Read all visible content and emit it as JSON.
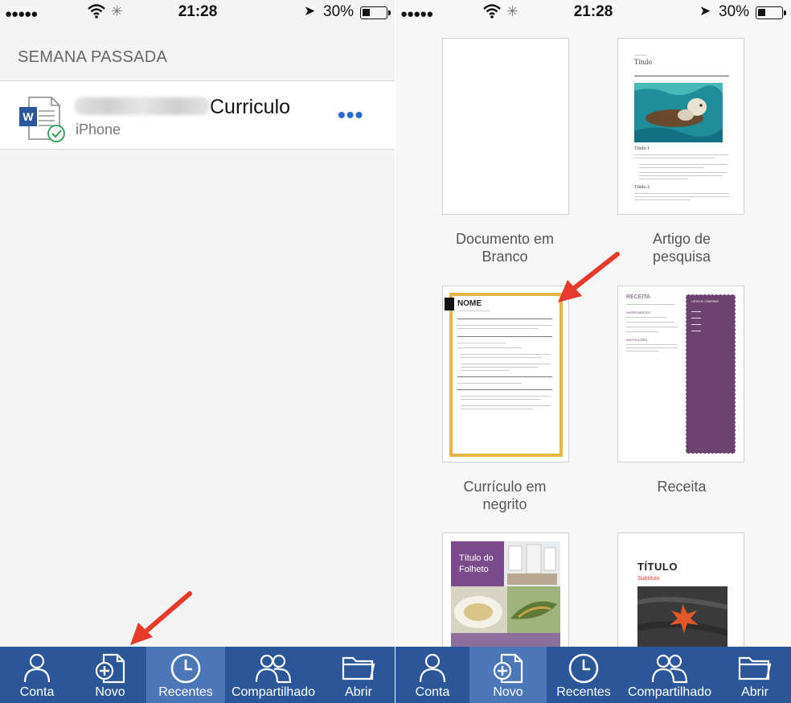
{
  "status_bar": {
    "signal": "●●●●●",
    "time": "21:28",
    "battery": "30%"
  },
  "left": {
    "section_title": "SEMANA PASSADA",
    "recent_files": [
      {
        "name": "Curriculo",
        "location": "iPhone",
        "more": "•••"
      }
    ]
  },
  "tabbar": {
    "tabs": [
      {
        "label": "Conta",
        "icon": "person-icon"
      },
      {
        "label": "Novo",
        "icon": "new-document-icon"
      },
      {
        "label": "Recentes",
        "icon": "clock-icon"
      },
      {
        "label": "Compartilhado",
        "icon": "people-icon"
      },
      {
        "label": "Abrir",
        "icon": "folder-icon"
      }
    ],
    "left_active": "Recentes",
    "right_active": "Novo"
  },
  "right": {
    "templates": [
      {
        "label_line1": "Documento em",
        "label_line2": "Branco"
      },
      {
        "label_line1": "Artigo de",
        "label_line2": "pesquisa",
        "thumb_title": "Título",
        "thumb_heading1": "Título 1",
        "thumb_heading2": "Título 2"
      },
      {
        "label_line1": "Currículo em",
        "label_line2": "negrito",
        "thumb_title": "NOME"
      },
      {
        "label_line1": "Receita",
        "label_line2": "",
        "thumb_title": "RECEITA",
        "thumb_sidebar_title": "LISTA DE COMPRAS",
        "thumb_ingredients": "INGREDIENTES",
        "thumb_instructions": "INSTRUÇÕES"
      },
      {
        "label_line1": "",
        "label_line2": "",
        "thumb_title_line1": "Título do",
        "thumb_title_line2": "Folheto"
      },
      {
        "label_line1": "",
        "label_line2": "",
        "thumb_title": "TÍTULO",
        "thumb_subtitle": "Subtítulo"
      }
    ]
  },
  "colors": {
    "word_blue": "#2b579a",
    "tab_active": "#4b77b8",
    "annotation_red": "#e8392d",
    "resume_border": "#e6b64a",
    "recipe_purple": "#6c4270",
    "brochure_purple": "#7b4a8a"
  }
}
